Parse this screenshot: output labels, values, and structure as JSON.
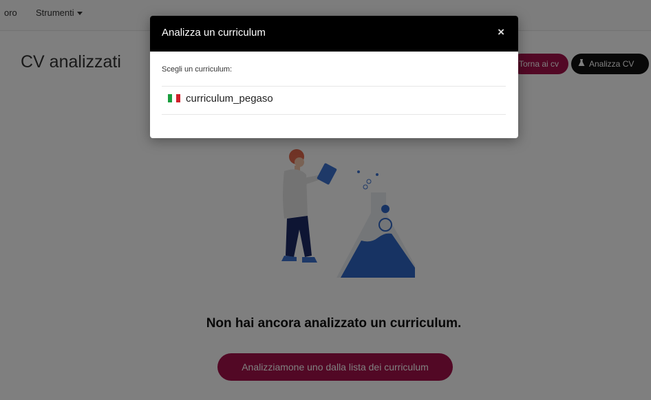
{
  "topnav": {
    "item_partial": "oro",
    "tools_label": "Strumenti"
  },
  "page": {
    "title": "CV analizzati",
    "back_button": "Torna ai cv",
    "analyze_button": "Analizza CV",
    "empty_message": "Non hai ancora analizzato un curriculum.",
    "cta_button": "Analizziamone uno dalla lista dei curriculum"
  },
  "modal": {
    "title": "Analizza un curriculum",
    "close_glyph": "×",
    "label": "Scegli un curriculum:",
    "items": [
      {
        "name": "curriculum_pegaso",
        "flag": "flag-italy-icon"
      }
    ]
  },
  "colors": {
    "brand": "#a5114b",
    "dark": "#111111",
    "illustration_blue": "#2f67c7"
  }
}
